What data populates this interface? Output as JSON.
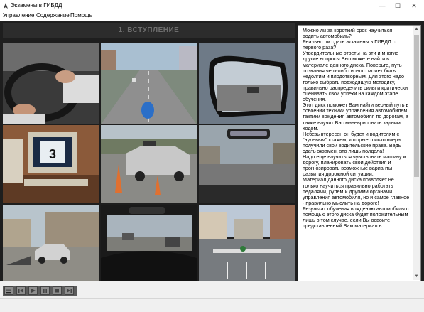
{
  "window": {
    "title": "Экзамены в ГИБДД"
  },
  "menu": {
    "items": [
      "Управление",
      "Содержание",
      "Помощь"
    ]
  },
  "section": {
    "heading": "1. ВСТУПЛЕНИЕ"
  },
  "photos": [
    {
      "name": "photo-hands-on-steering-wheel",
      "icon": "steering-wheel"
    },
    {
      "name": "photo-road-blue-car",
      "icon": "road"
    },
    {
      "name": "photo-side-mirror",
      "icon": "mirror"
    },
    {
      "name": "photo-computer-exam",
      "icon": "computer",
      "digit": "3"
    },
    {
      "name": "photo-training-car-cones",
      "icon": "car"
    },
    {
      "name": "photo-city-road-mirror",
      "icon": "road"
    },
    {
      "name": "photo-car-on-ramp",
      "icon": "car"
    },
    {
      "name": "photo-driver-view-traffic",
      "icon": "road"
    },
    {
      "name": "photo-intersection-markings",
      "icon": "intersection"
    }
  ],
  "intro_text": "Можно ли за короткий срок научиться водить автомобиль?\n   Реально ли сдать экзамены в ГИБДД с первого раза?\n   Утвердительные ответы на эти и многие другие вопросы Вы сможете найти в материале данного диска. Поверьте, путь познания чего-либо нового может быть недолгим и плодотворным. Для этого надо только выбрать подходящую методику, правильно распределить силы и критически оценивать свои успехи на каждом этапе обучения.\n   Этот диск поможет Вам найти верный путь в освоении техники управления автомобилем, тактики вождения автомобиля по дорогам, а также научит Вас маневрировать задним ходом.\n   Небезынтересен он будет и водителям с \"нулевым\" стажем, которые только вчера получили свои водительские права. Ведь сдать экзамен, это лишь полдела!\n   Надо еще научиться чувствовать машину и дорогу, планировать свои действия и прогнозировать возможные варианты развития дорожной ситуации.\n   Материал данного диска позволяет не только научиться правильно работать педалями, рулем и другими органами управления автомобиля, но и самое главное - правильно мыслить на дороге!\n   Результат обучения вождению автомобиля с помощью этого диска будет положительным лишь в том случае, если Вы освоите представленный Вам материал в",
  "controls": [
    "list-icon",
    "first-icon",
    "play-icon",
    "pause-icon",
    "stop-icon",
    "last-icon"
  ]
}
